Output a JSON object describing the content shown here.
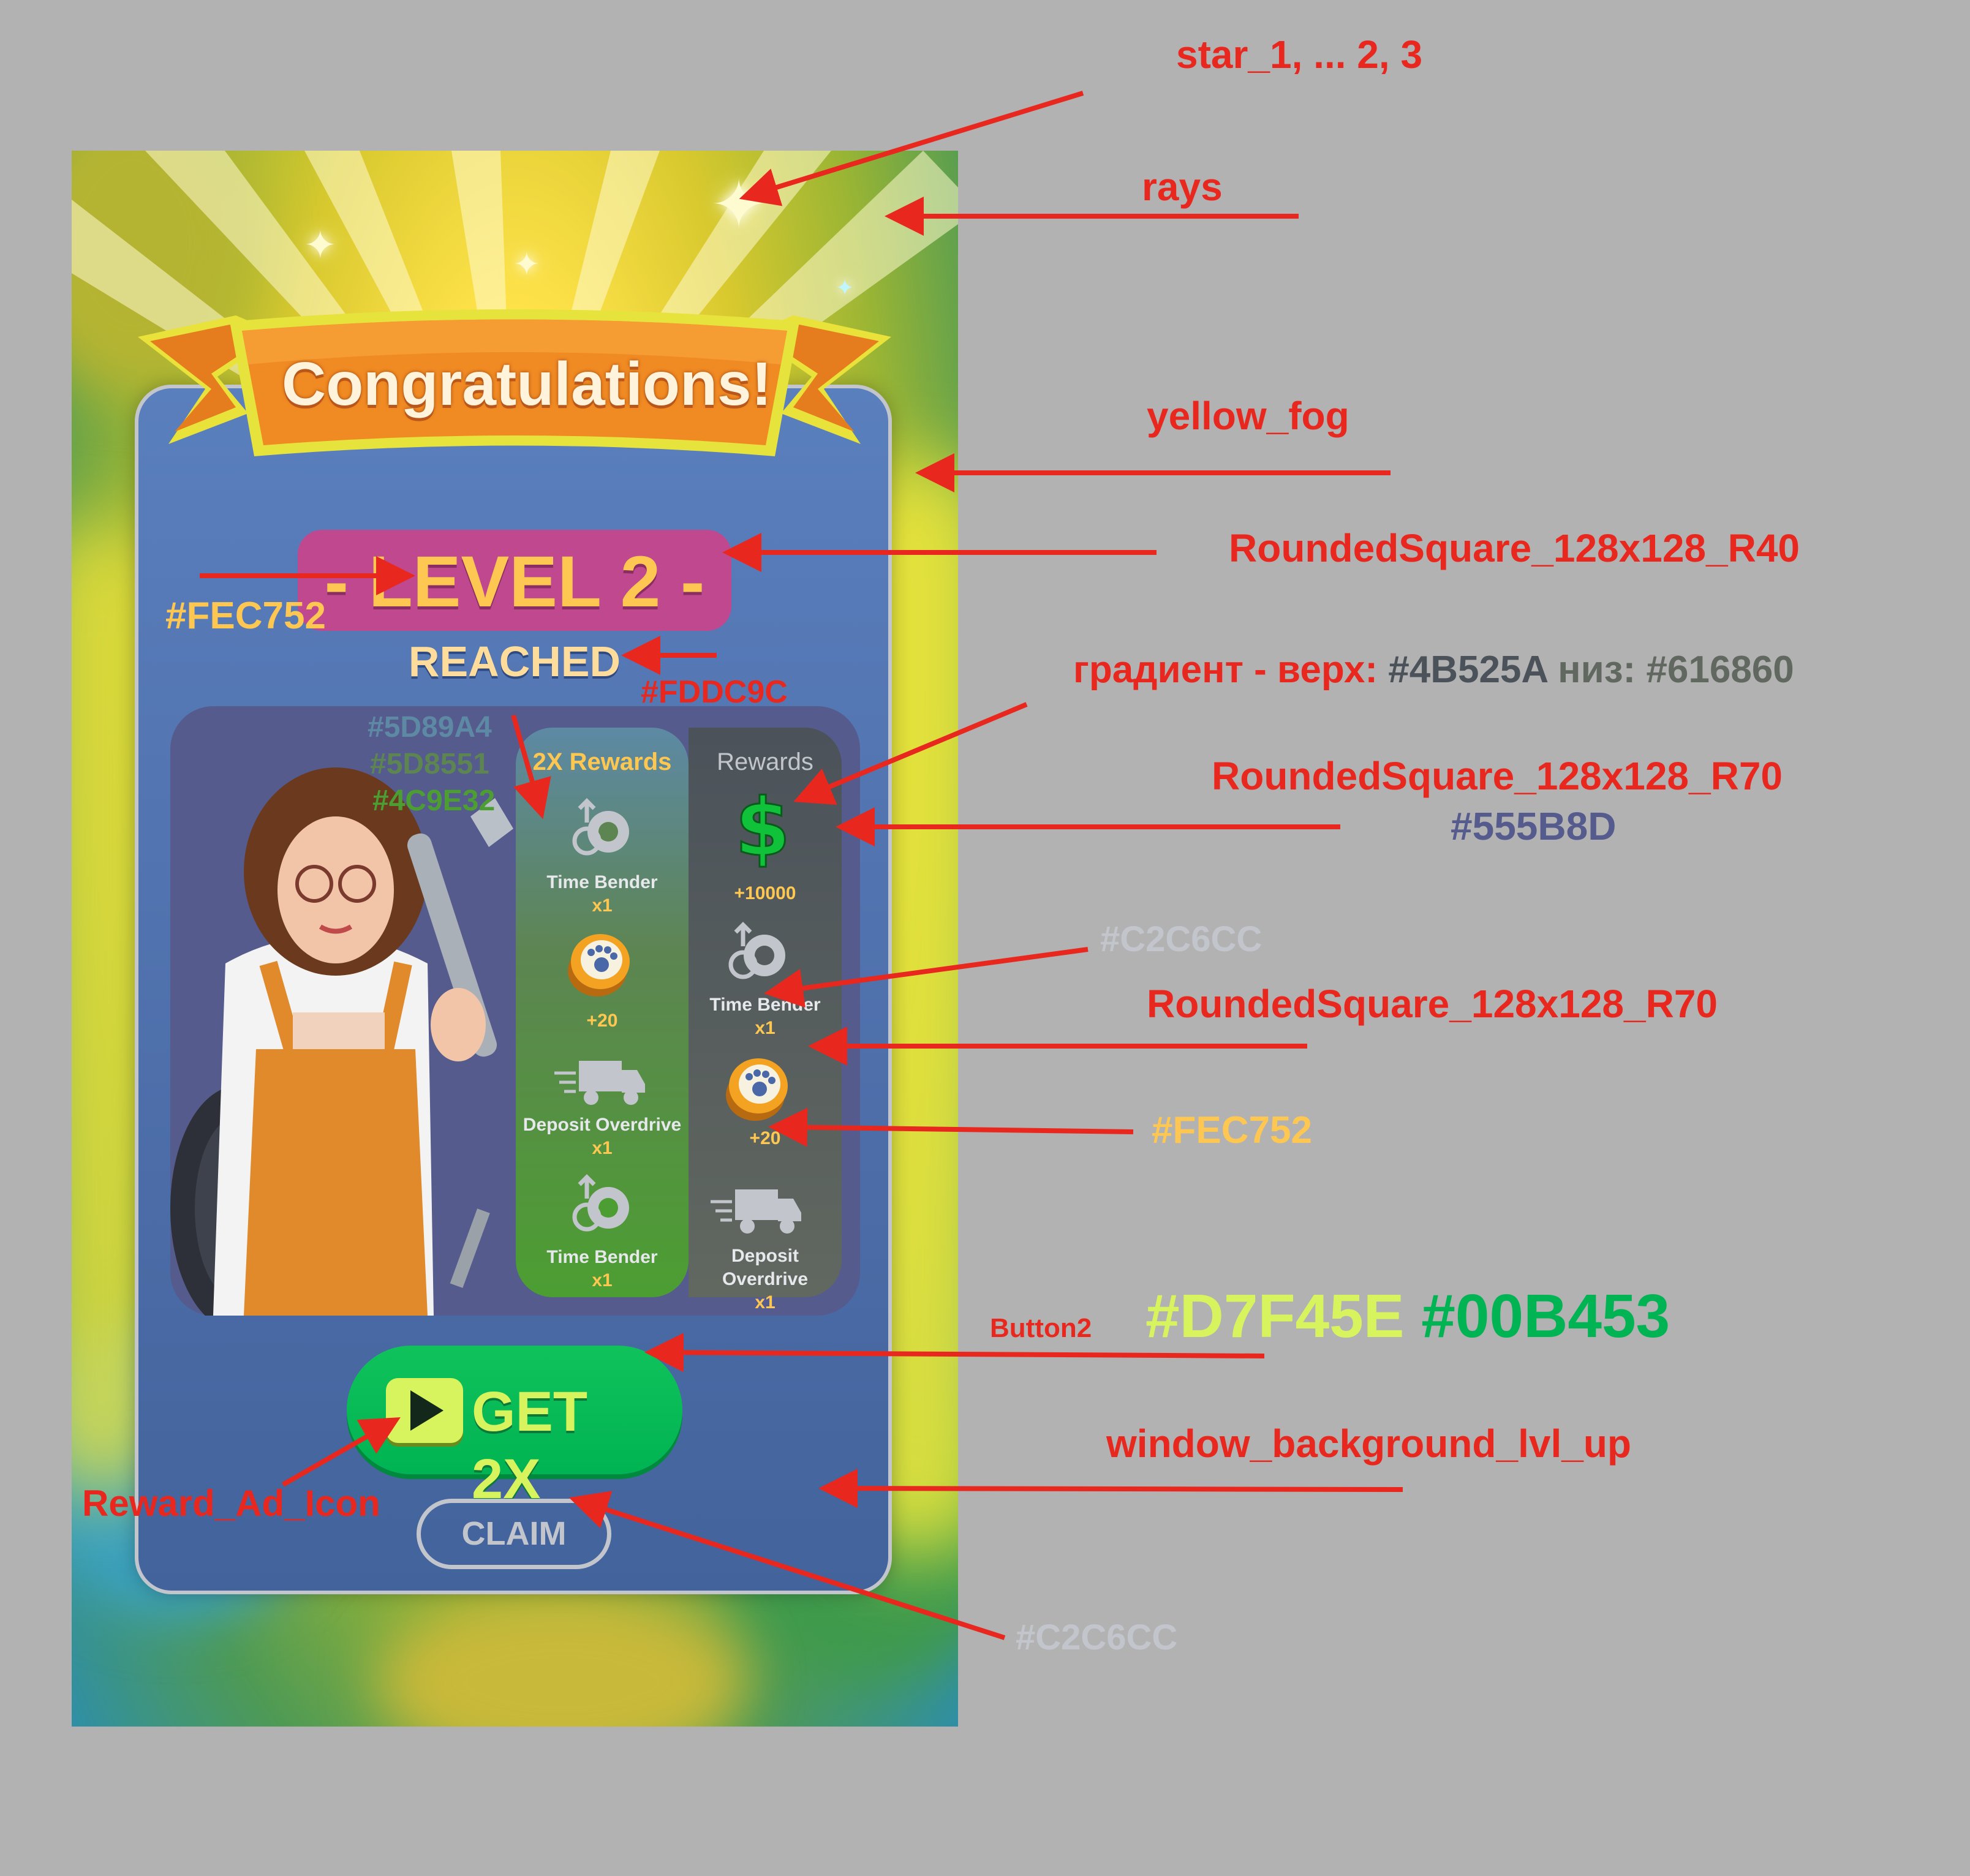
{
  "game": {
    "title": "Congratulations!",
    "level_text": "- LEVEL 2 -",
    "reached": "REACHED",
    "col_2x_title": "2X Rewards",
    "col_std_title": "Rewards",
    "rewards_2x": [
      {
        "icon": "time-bender-gear-icon",
        "name": "Time Bender",
        "qty": "x1"
      },
      {
        "icon": "paw-coin-icon",
        "name": "",
        "qty": "+20"
      },
      {
        "icon": "deposit-truck-icon",
        "name": "Deposit Overdrive",
        "qty": "x1"
      },
      {
        "icon": "time-bender-gear-icon",
        "name": "Time Bender",
        "qty": "x1"
      }
    ],
    "rewards_std": [
      {
        "icon": "dollar-icon",
        "name": "",
        "qty": "+10000"
      },
      {
        "icon": "time-bender-gear-icon",
        "name": "Time Bender",
        "qty": "x1"
      },
      {
        "icon": "paw-coin-icon",
        "name": "",
        "qty": "+20"
      },
      {
        "icon": "deposit-truck-icon",
        "name": "Deposit Overdrive",
        "qty": "x1"
      }
    ],
    "get2x_label": "GET 2X",
    "claim_label": "CLAIM"
  },
  "annotations": {
    "stars": "star_1, ... 2, 3",
    "rays": "rays",
    "yellow_fog": "yellow_fog",
    "rounded_r40": "RoundedSquare_128x128_R40",
    "fec752_left": "#FEC752",
    "fddc9c": "#FDDC9C",
    "gradient_prefix": "градиент - верх:",
    "gradient_top": "#4B525A",
    "gradient_mid": "низ:",
    "gradient_bottom": "#616860",
    "rounded_r70_a": "RoundedSquare_128x128_R70",
    "box_color": "#555B8D",
    "c2c6cc_a": "#C2C6CC",
    "rounded_r70_b": "RoundedSquare_128x128_R70",
    "fec752_right": "#FEC752",
    "col2x_top": "#5D89A4",
    "col2x_mid": "#5D8551",
    "col2x_bottom": "#4C9E32",
    "button2": "Button2",
    "btn_color_1": "#D7F45E",
    "btn_color_2": "#00B453",
    "window_bg": "window_background_lvl_up",
    "reward_ad_icon": "Reward_Ad_Icon",
    "c2c6cc_b": "#C2C6CC"
  },
  "colors": {
    "annotation_red": "#e8281e",
    "level_text": "#FEC752",
    "reached_text": "#FDDC9C",
    "box": "#555B8D",
    "outline_gray": "#C2C6CC",
    "button_yellow": "#D7F45E",
    "button_green": "#00B453",
    "gradient_top": "#4B525A",
    "gradient_bottom": "#616860",
    "col2x_top": "#5D89A4",
    "col2x_mid": "#5D8551",
    "col2x_bottom": "#4C9E32"
  }
}
